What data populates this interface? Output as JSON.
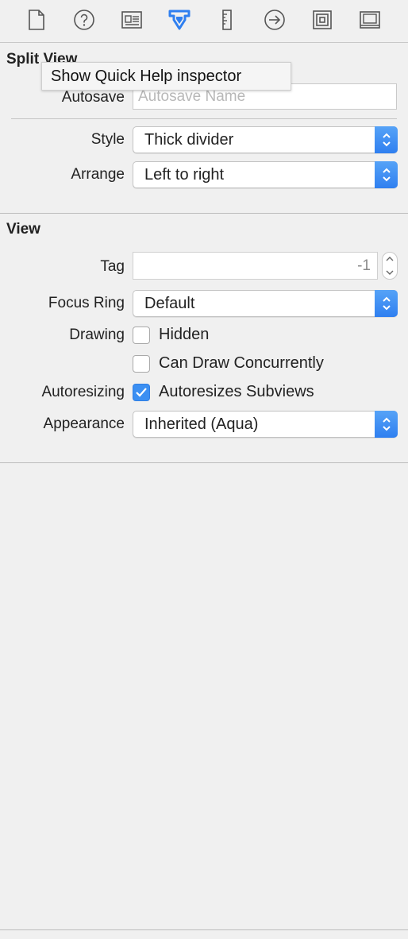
{
  "toolbar": {
    "icons": [
      {
        "name": "file-inspector-icon",
        "selected": false
      },
      {
        "name": "quick-help-inspector-icon",
        "selected": false
      },
      {
        "name": "identity-inspector-icon",
        "selected": false
      },
      {
        "name": "attributes-inspector-icon",
        "selected": true
      },
      {
        "name": "size-inspector-icon",
        "selected": false
      },
      {
        "name": "connections-inspector-icon",
        "selected": false
      },
      {
        "name": "bindings-inspector-icon",
        "selected": false
      },
      {
        "name": "view-effects-inspector-icon",
        "selected": false
      }
    ],
    "accent_color": "#2f7ff0"
  },
  "tooltip": "Show Quick Help inspector",
  "split_view": {
    "title": "Split View",
    "autosave_label": "Autosave",
    "autosave_placeholder": "Autosave Name",
    "style_label": "Style",
    "style_value": "Thick divider",
    "arrange_label": "Arrange",
    "arrange_value": "Left to right"
  },
  "view": {
    "title": "View",
    "tag_label": "Tag",
    "tag_value": "-1",
    "focus_ring_label": "Focus Ring",
    "focus_ring_value": "Default",
    "drawing_label": "Drawing",
    "hidden_label": "Hidden",
    "hidden_checked": false,
    "concurrent_label": "Can Draw Concurrently",
    "concurrent_checked": false,
    "autoresizing_label": "Autoresizing",
    "autoresizes_label": "Autoresizes Subviews",
    "autoresizes_checked": true,
    "appearance_label": "Appearance",
    "appearance_value": "Inherited (Aqua)"
  }
}
